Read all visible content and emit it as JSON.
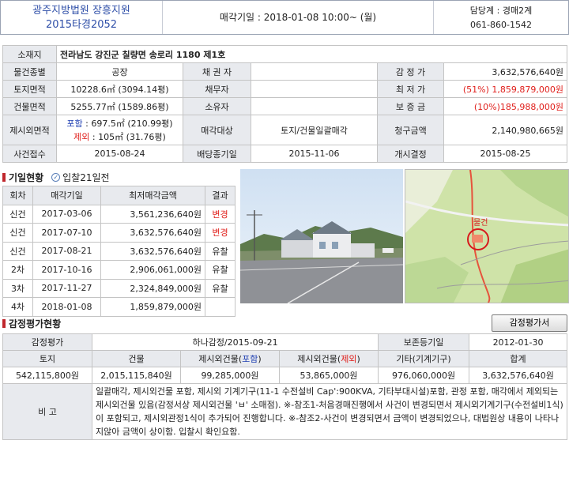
{
  "header": {
    "court": "광주지방법원 장흥지원",
    "case_no": "2015타경2052",
    "sale_date": "매각기일 : 2018-01-08  10:00~ (월)",
    "dept": "담당계 : 경매2계",
    "phone": "061-860-1542"
  },
  "info": {
    "address_label": "소재지",
    "address": "전라남도 강진군 칠량면 송로리 1180 제1호",
    "type_label": "물건종별",
    "type": "공장",
    "creditor_label": "채 권 자",
    "appraisal_label": "감 정 가",
    "appraisal": "3,632,576,640원",
    "land_area_label": "토지면적",
    "land_area": "10228.6㎡ (3094.14평)",
    "debtor_label": "채무자",
    "min_price_label": "최 저 가",
    "min_price": "(51%) 1,859,879,000원",
    "building_area_label": "건물면적",
    "building_area": "5255.77㎡ (1589.86평)",
    "owner_label": "소유자",
    "deposit_label": "보 증 금",
    "deposit": "(10%)185,988,000원",
    "excluded_label": "제시외면적",
    "included_prefix": "포함",
    "included_value": " : 697.5㎡ (210.99평)",
    "excluded_prefix": "제외",
    "excluded_value": " : 105㎡ (31.76평)",
    "sale_target_label": "매각대상",
    "sale_target": "토지/건물일괄매각",
    "claim_label": "청구금액",
    "claim": "2,140,980,665원",
    "received_label": "사건접수",
    "received": "2015-08-24",
    "dividend_label": "배당종기일",
    "dividend": "2015-11-06",
    "commenced_label": "개시결정",
    "commenced": "2015-08-25"
  },
  "bid_section": {
    "title": "기일현황",
    "sub": "입찰21일전",
    "headers": [
      "회차",
      "매각기일",
      "최저매각금액",
      "결과"
    ],
    "rows": [
      {
        "round": "신건",
        "date": "2017-03-06",
        "price": "3,561,236,640원",
        "result": "변경"
      },
      {
        "round": "신건",
        "date": "2017-07-10",
        "price": "3,632,576,640원",
        "result": "변경"
      },
      {
        "round": "신건",
        "date": "2017-08-21",
        "price": "3,632,576,640원",
        "result": "유찰"
      },
      {
        "round": "2차",
        "date": "2017-10-16",
        "price": "2,906,061,000원",
        "result": "유찰"
      },
      {
        "round": "3차",
        "date": "2017-11-27",
        "price": "2,324,849,000원",
        "result": "유찰"
      },
      {
        "round": "4차",
        "date": "2018-01-08",
        "price": "1,859,879,000원",
        "result": ""
      }
    ]
  },
  "map": {
    "marker_label": "물건"
  },
  "appraisal_section": {
    "title": "감정평가현황",
    "button": "감정평가서",
    "label": "감정평가",
    "agency": "하나감정/2015-09-21",
    "registry_label": "보존등기일",
    "registry": "2012-01-30",
    "headers": {
      "land": "토지",
      "building": "건물",
      "inc_prefix": "제시외건물(",
      "inc_word": "포함",
      "exc_prefix": "제시외건물(",
      "exc_word": "제외",
      "close": ")",
      "other": "기타(기계기구)",
      "total": "합계"
    },
    "values": {
      "land": "542,115,800원",
      "building": "2,015,115,840원",
      "inc": "99,285,000원",
      "exc": "53,865,000원",
      "other": "976,060,000원",
      "total": "3,632,576,640원"
    },
    "note_label": "비 고",
    "note": "일괄매각, 제시외건물 포함, 제시외 기계기구(11-1 수전설비 Cap':900KVA, 기타부대시설)포함, 관정 포함, 매각에서 제외되는 제시외건물 있음(감정서상 제시외건물 'ㅂ' 소매점). ※-참조1-처음경매진행에서 사건이 변경되면서 제시외기계기구(수전설비1식)이 포함되고, 제시외관정1식이 추가되어 진행합니다. ※-참조2-사건이 변경되면서 금액이 변경되었으나, 대법원상 내용이 나타나지않아 금액이 상이함. 입찰시 확인요함."
  },
  "colors": {
    "court_blue": "#2f4fa8",
    "label_bg": "#e8eaee",
    "changed_red": "#e0201c",
    "accent_red": "#c0272d"
  }
}
